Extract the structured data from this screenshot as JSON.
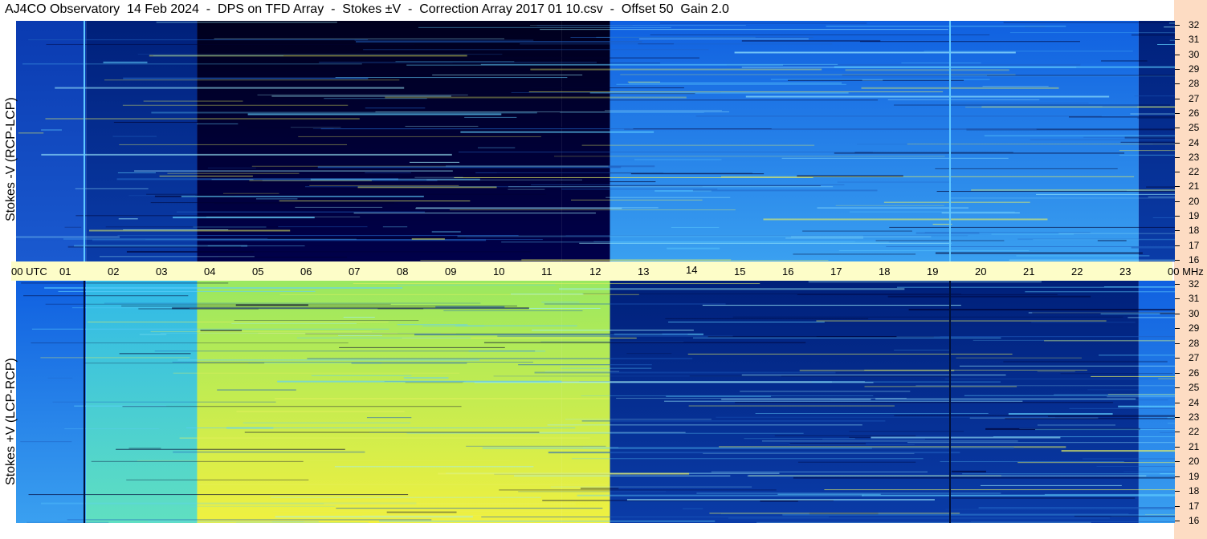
{
  "header": {
    "title": "AJ4CO Observatory  14 Feb 2024  -  DPS on TFD Array  -  Stokes ±V  -  Correction Array 2017 01 10.csv  -  Offset 50  Gain 2.0"
  },
  "chart_data": [
    {
      "type": "heatmap",
      "title": "AJ4CO Observatory  14 Feb 2024  -  DPS on TFD Array  -  Stokes ±V  -  Correction Array 2017 01 10.csv  -  Offset 50  Gain 2.0",
      "ylabel": "Stokes -V (RCP-LCP)",
      "xlabel": "UTC",
      "x_ticks": [
        "00 UTC",
        "01",
        "02",
        "03",
        "04",
        "05",
        "06",
        "07",
        "08",
        "09",
        "10",
        "11",
        "12",
        "13",
        "14",
        "15",
        "16",
        "17",
        "18",
        "19",
        "20",
        "21",
        "22",
        "23",
        "00"
      ],
      "xlim": [
        0,
        24
      ],
      "y_unit": "MHz",
      "y_ticks": [
        "16",
        "17",
        "18",
        "19",
        "20",
        "21",
        "22",
        "23",
        "24",
        "25",
        "26",
        "27",
        "28",
        "29",
        "30",
        "31",
        "32"
      ],
      "ylim": [
        16,
        32
      ],
      "colormap": "jet",
      "segments": [
        {
          "x": [
            0.0,
            1.45
          ],
          "level": "mid-low"
        },
        {
          "x": [
            1.45,
            3.75
          ],
          "level": "low"
        },
        {
          "x": [
            3.75,
            11.3
          ],
          "level": "very low"
        },
        {
          "x": [
            11.3,
            12.3
          ],
          "level": "very low"
        },
        {
          "x": [
            12.3,
            23.25
          ],
          "level": "mid"
        },
        {
          "x": [
            23.25,
            24.0
          ],
          "level": "low"
        }
      ]
    },
    {
      "type": "heatmap",
      "ylabel": "Stokes +V (LCP-RCP)",
      "xlabel": "UTC",
      "x_ticks": [
        "00 UTC",
        "01",
        "02",
        "03",
        "04",
        "05",
        "06",
        "07",
        "08",
        "09",
        "10",
        "11",
        "12",
        "13",
        "14",
        "15",
        "16",
        "17",
        "18",
        "19",
        "20",
        "21",
        "22",
        "23",
        "00"
      ],
      "xlim": [
        0,
        24
      ],
      "y_unit": "MHz",
      "y_ticks": [
        "16",
        "17",
        "18",
        "19",
        "20",
        "21",
        "22",
        "23",
        "24",
        "25",
        "26",
        "27",
        "28",
        "29",
        "30",
        "31",
        "32"
      ],
      "ylim": [
        16,
        32
      ],
      "colormap": "jet",
      "segments": [
        {
          "x": [
            0.0,
            1.45
          ],
          "level": "mid"
        },
        {
          "x": [
            1.45,
            3.75
          ],
          "level": "mid-high"
        },
        {
          "x": [
            3.75,
            11.3
          ],
          "level": "high"
        },
        {
          "x": [
            11.3,
            12.3
          ],
          "level": "high"
        },
        {
          "x": [
            12.3,
            23.25
          ],
          "level": "low"
        },
        {
          "x": [
            23.25,
            24.0
          ],
          "level": "mid"
        }
      ]
    }
  ],
  "colors": {
    "xstrip": "#fdfdc8",
    "rstrip": "#fddcc3"
  },
  "axis": {
    "x_ticks": [
      "00 UTC",
      "01",
      "02",
      "03",
      "04",
      "05",
      "06",
      "07",
      "08",
      "09",
      "10",
      "11",
      "12",
      "13",
      "14",
      "15",
      "16",
      "17",
      "18",
      "19",
      "20",
      "21",
      "22",
      "23",
      "00 MHz"
    ],
    "y_ticks": [
      "16",
      "17",
      "18",
      "19",
      "20",
      "21",
      "22",
      "23",
      "24",
      "25",
      "26",
      "27",
      "28",
      "29",
      "30",
      "31",
      "32"
    ]
  }
}
